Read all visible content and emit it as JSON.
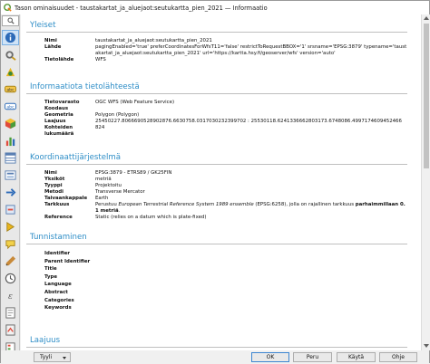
{
  "window": {
    "title": "Tason ominaisuudet - taustakartat_ja_aluejaot:seutukartta_pien_2021 — Informaatio"
  },
  "sidebar": {
    "search_icon": "search-icon",
    "items": [
      {
        "icon": "information-icon",
        "active": true
      },
      {
        "icon": "source-settings-icon",
        "active": false
      },
      {
        "icon": "symbology-icon",
        "active": false
      },
      {
        "icon": "labels-icon",
        "active": false
      },
      {
        "icon": "masks-icon",
        "active": false
      },
      {
        "icon": "3d-view-icon",
        "active": false
      },
      {
        "icon": "diagrams-icon",
        "active": false
      },
      {
        "icon": "fields-icon",
        "active": false
      },
      {
        "icon": "attributes-form-icon",
        "active": false
      },
      {
        "icon": "joins-icon",
        "active": false
      },
      {
        "icon": "auxiliary-storage-icon",
        "active": false
      },
      {
        "icon": "actions-icon",
        "active": false
      },
      {
        "icon": "display-icon",
        "active": false
      },
      {
        "icon": "rendering-icon",
        "active": false
      },
      {
        "icon": "temporal-icon",
        "active": false
      },
      {
        "icon": "variables-icon",
        "active": false
      },
      {
        "icon": "metadata-icon",
        "active": false
      },
      {
        "icon": "dependencies-icon",
        "active": false
      }
    ]
  },
  "general": {
    "heading": "Yleiset",
    "rows": [
      {
        "key": "Nimi",
        "value": "taustakartat_ja_aluejaot:seutukartta_pien_2021"
      },
      {
        "key": "Lähde",
        "value": "pagingEnabled='true' preferCoordinatesForWfsT11='false' restrictToRequestBBOX='1' srsname='EPSG:3879' typename='taustakartat_ja_aluejaot:seutukartta_pien_2021' url='https://kartta.hsy.fi/geoserver/wfs' version='auto'"
      },
      {
        "key": "Tietolähde",
        "value": "WFS"
      }
    ]
  },
  "source_info": {
    "heading": "Informaatiota tietolähteestä",
    "rows": [
      {
        "key": "Tietovarasto",
        "value": "OGC WFS (Web Feature Service)"
      },
      {
        "key": "Koodaus",
        "value": ""
      },
      {
        "key": "Geometria",
        "value": "Polygon (Polygon)"
      },
      {
        "key": "Laajuus",
        "value": "25450227.8066690528902876.6630758.0317030232399702 : 25530118.6241336662803173.6748086.4997174609452466"
      },
      {
        "key": "Kohteiden lukumäärä",
        "value": "824"
      }
    ]
  },
  "crs": {
    "heading": "Koordinaattijärjestelmä",
    "rows": [
      {
        "key": "Nimi",
        "value": "EPSG:3879 - ETRS89 / GK25FIN"
      },
      {
        "key": "Yksiköt",
        "value": "metriä"
      },
      {
        "key": "Tyyppi",
        "value": "Projektoitu"
      },
      {
        "key": "Metodi",
        "value": "Transverse Mercator"
      },
      {
        "key": "Taivaankappale",
        "value": "Earth"
      },
      {
        "key": "Tarkkuus",
        "value_parts": [
          "Perustuu ",
          "European Terrestrial Reference System 1989 ensemble",
          " (EPSG:6258), jolla on rajallinen tarkkuus ",
          "parhaimmillaan 0.1 metriä",
          "."
        ]
      },
      {
        "key": "Reference",
        "value": "Static (relies on a datum which is plate-fixed)"
      }
    ]
  },
  "identification": {
    "heading": "Tunnistaminen",
    "rows": [
      {
        "key": "Identifier",
        "value": ""
      },
      {
        "key": "Parent Identifier",
        "value": ""
      },
      {
        "key": "Title",
        "value": ""
      },
      {
        "key": "Type",
        "value": ""
      },
      {
        "key": "Language",
        "value": ""
      },
      {
        "key": "Abstract",
        "value": ""
      },
      {
        "key": "Categories",
        "value": ""
      },
      {
        "key": "Keywords",
        "value": ""
      }
    ]
  },
  "extent": {
    "heading": "Laajuus"
  },
  "footer": {
    "style_label": "Tyyli",
    "ok_label": "OK",
    "cancel_label": "Peru",
    "apply_label": "Käytä",
    "help_label": "Ohje"
  },
  "colors": {
    "heading": "#2f8ec7",
    "active_item": "#cfe3f7"
  }
}
